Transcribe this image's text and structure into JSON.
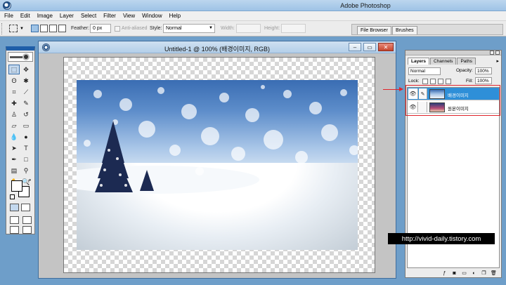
{
  "app": {
    "title": "Adobe Photoshop"
  },
  "menu": [
    "File",
    "Edit",
    "Image",
    "Layer",
    "Select",
    "Filter",
    "View",
    "Window",
    "Help"
  ],
  "options": {
    "feather_label": "Feather:",
    "feather_value": "0 px",
    "antialiased_label": "Anti-aliased",
    "style_label": "Style:",
    "style_value": "Normal",
    "width_label": "Width:",
    "height_label": "Height:"
  },
  "palette_well": {
    "tabs": [
      "File Browser",
      "Brushes"
    ]
  },
  "document": {
    "title": "Untitled-1 @ 100% (배경이미지, RGB)"
  },
  "layers_palette": {
    "tabs": [
      "Layers",
      "Channels",
      "Paths"
    ],
    "blend_mode": "Normal",
    "opacity_label": "Opacity:",
    "opacity_value": "100%",
    "lock_label": "Lock:",
    "fill_label": "Fill:",
    "fill_value": "100%",
    "layers": [
      {
        "name": "배경이미지",
        "selected": true
      },
      {
        "name": "원본이미지",
        "selected": false
      }
    ]
  },
  "watermark": "http://vivid-daily.tistory.com",
  "colors": {
    "accent": "#2e8fd8",
    "highlight": "#e0242b",
    "workspace": "#6e9ec9"
  }
}
